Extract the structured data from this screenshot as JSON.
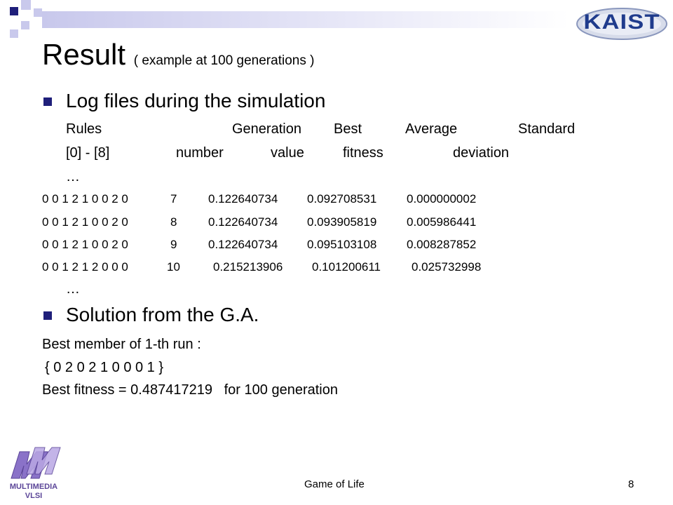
{
  "logos": {
    "kaist": "KAIST",
    "multimedia_line1": "MULTIMEDIA",
    "multimedia_line2": "VLSI"
  },
  "title": {
    "main": "Result",
    "subtitle": "( example at 100 generations )"
  },
  "log_section": {
    "heading": "Log files during the simulation",
    "header_row1": [
      "Rules",
      "Generation",
      "Best",
      "Average",
      "Standard"
    ],
    "header_row2": [
      "[0] - [8]",
      "number",
      "value",
      "fitness",
      "deviation"
    ],
    "ellipsis": "…",
    "rows": [
      {
        "rules": "0 0 1 2 1 0 0 2 0",
        "gen": "7",
        "best": "0.122640734",
        "avg": "0.092708531",
        "std": "0.000000002"
      },
      {
        "rules": "0 0 1 2 1 0 0 2 0",
        "gen": "8",
        "best": "0.122640734",
        "avg": "0.093905819",
        "std": "0.005986441"
      },
      {
        "rules": "0 0 1 2 1 0 0 2 0",
        "gen": "9",
        "best": "0.122640734",
        "avg": "0.095103108",
        "std": "0.008287852"
      },
      {
        "rules": "0 0 1 2 1 2 0 0 0",
        "gen": "10",
        "best": "0.215213906",
        "avg": "0.101200611",
        "std": "0.025732998"
      }
    ]
  },
  "solution_section": {
    "heading": "Solution from the G.A.",
    "line1": "Best member of 1-th run :",
    "line2": "{ 0 2 0 2 1 0 0 0 1 }",
    "line3": "Best fitness = 0.487417219   for 100 generation"
  },
  "footer": {
    "center": "Game of Life",
    "page": "8"
  },
  "colors": {
    "bullet": "#1f1f7a",
    "accent_light": "#c9c9ec",
    "kaist_blue": "#1f3b8c"
  }
}
